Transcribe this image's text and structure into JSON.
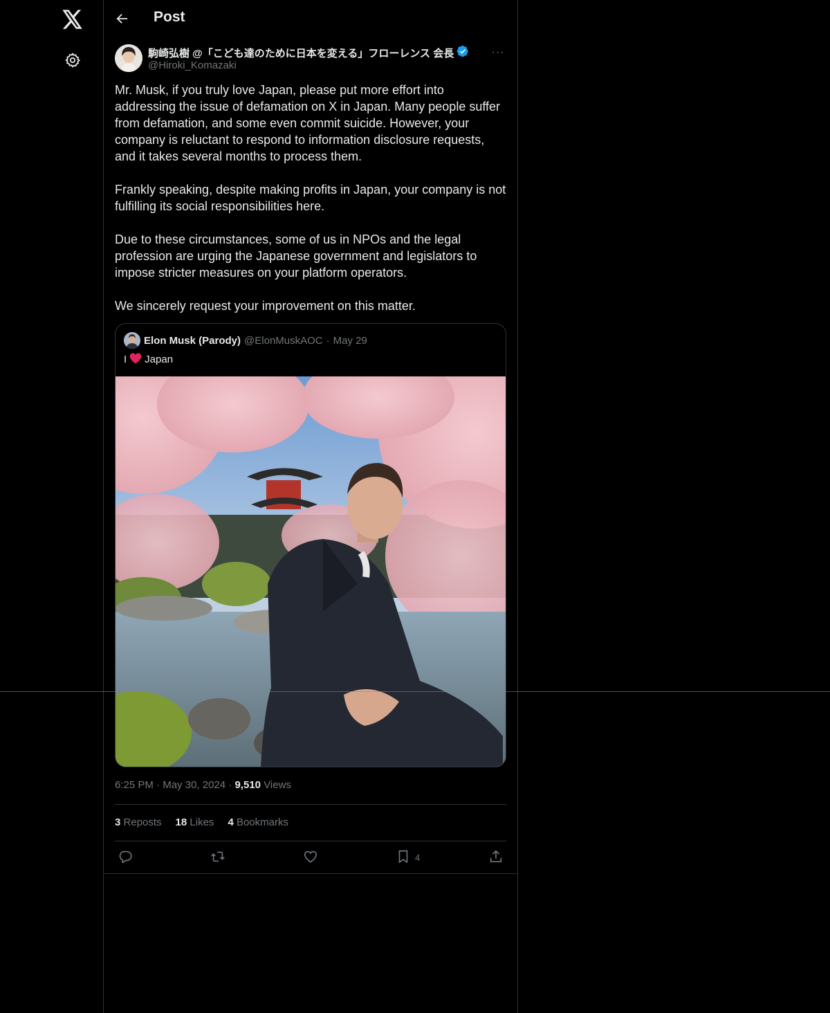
{
  "header": {
    "title": "Post"
  },
  "post": {
    "author_name": "駒崎弘樹 @「こども達のために日本を変える」フローレンス 会長",
    "author_handle": "@Hiroki_Komazaki",
    "more_label": "···",
    "paragraphs": [
      "Mr. Musk, if you truly love Japan, please put more effort into addressing the issue of defamation on X in Japan. Many people suffer from defamation, and some even commit suicide. However, your company is reluctant to respond to information disclosure requests, and it takes several months to process them.",
      "Frankly speaking, despite making profits in Japan, your company is not fulfilling its social responsibilities here.",
      "Due to these circumstances, some of us in NPOs and the legal profession are urging the Japanese government and legislators to impose stricter measures on your platform operators.",
      "We sincerely request your improvement on this matter."
    ],
    "time": "6:25 PM",
    "date": "May 30, 2024",
    "views_count": "9,510",
    "views_label": "Views",
    "sep": "·"
  },
  "quote": {
    "name": "Elon Musk (Parody)",
    "handle": "@ElonMuskAOC",
    "sep": "·",
    "date": "May 29",
    "text_before": "I",
    "text_after": "Japan"
  },
  "stats": {
    "reposts_count": "3",
    "reposts_label": "Reposts",
    "likes_count": "18",
    "likes_label": "Likes",
    "bookmarks_count": "4",
    "bookmarks_label": "Bookmarks"
  },
  "actions": {
    "bookmark_count": "4"
  },
  "icons": [
    "x-logo-icon",
    "gear-icon",
    "back-arrow-icon",
    "verified-badge-icon",
    "more-icon",
    "heart-emoji-icon",
    "reply-icon",
    "repost-icon",
    "like-icon",
    "bookmark-icon",
    "share-icon"
  ],
  "colors": {
    "background": "#000000",
    "text": "#e7e9ea",
    "muted": "#71767b",
    "border": "#2f3336",
    "verified": "#1d9bf0",
    "heart": "#e0245e"
  }
}
